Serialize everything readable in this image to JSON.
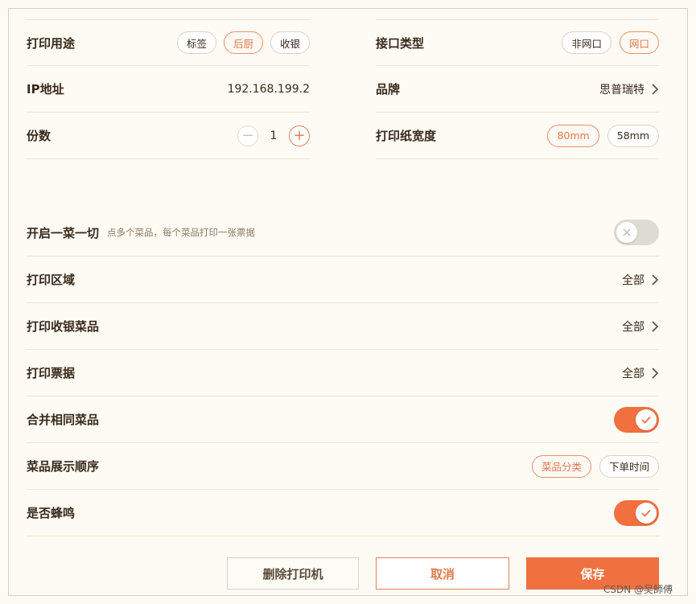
{
  "left_column": {
    "print_purpose": {
      "label": "打印用途",
      "options": [
        "标签",
        "后厨",
        "收银"
      ],
      "selected": "后厨"
    },
    "ip": {
      "label": "IP地址",
      "value": "192.168.199.2"
    },
    "copies": {
      "label": "份数",
      "minus": "−",
      "value": "1",
      "plus": "+"
    }
  },
  "right_column": {
    "interface": {
      "label": "接口类型",
      "options": [
        "非网口",
        "网口"
      ],
      "selected": "网口"
    },
    "brand": {
      "label": "品牌",
      "value": "思普瑞特"
    },
    "paper_width": {
      "label": "打印纸宽度",
      "options": [
        "80mm",
        "58mm"
      ],
      "selected": "80mm"
    }
  },
  "settings": {
    "one_dish_one_cut": {
      "label": "开启一菜一切",
      "hint": "点多个菜品，每个菜品打印一张票据",
      "toggle": "off"
    },
    "print_area": {
      "label": "打印区域",
      "value": "全部"
    },
    "print_cashier_dishes": {
      "label": "打印收银菜品",
      "value": "全部"
    },
    "print_receipts": {
      "label": "打印票据",
      "value": "全部"
    },
    "merge_same_dishes": {
      "label": "合并相同菜品",
      "toggle": "on"
    },
    "dish_display_order": {
      "label": "菜品展示顺序",
      "options": [
        "菜品分类",
        "下单时间"
      ],
      "selected": "菜品分类"
    },
    "beep": {
      "label": "是否蜂鸣",
      "toggle": "on"
    }
  },
  "buttons": {
    "delete": "删除打印机",
    "cancel": "取消",
    "save": "保存"
  },
  "watermark": "CSDN @吴師傅",
  "colors": {
    "accent": "#f0703f",
    "accent_border": "#e89268",
    "background": "#fdfbf4",
    "divider": "#ece7d6"
  }
}
